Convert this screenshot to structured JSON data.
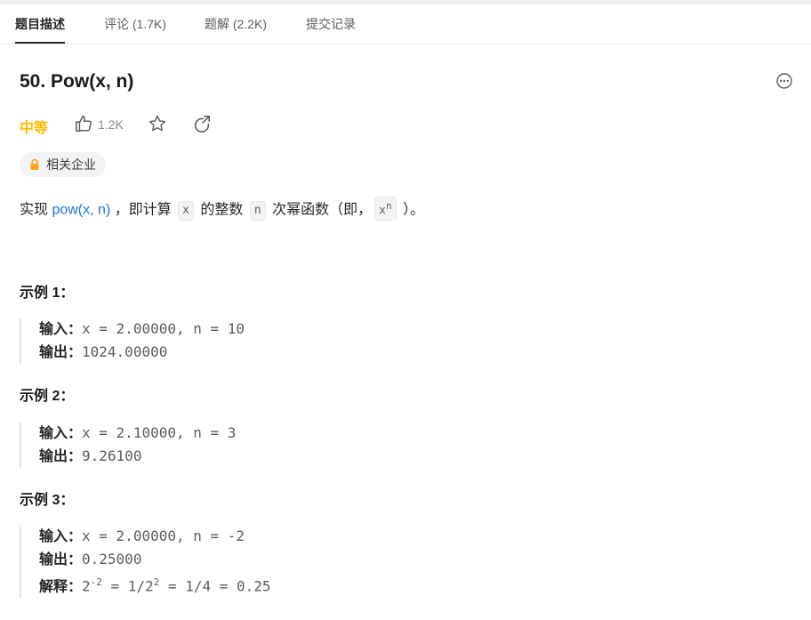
{
  "tabs": [
    {
      "label": "题目描述"
    },
    {
      "label": "评论 (1.7K)"
    },
    {
      "label": "题解 (2.2K)"
    },
    {
      "label": "提交记录"
    }
  ],
  "problem": {
    "title": "50. Pow(x, n)",
    "difficulty": "中等",
    "likes": "1.2K",
    "company_tag": "相关企业"
  },
  "description": {
    "part1": "实现 ",
    "link": "pow(x, n)",
    "part2": " ，即计算 ",
    "code_x": "x",
    "part3": " 的整数 ",
    "code_n": "n",
    "part4": " 次幂函数（即，",
    "power_base": "x",
    "power_exp": "n",
    "part5": " ）。"
  },
  "labels": {
    "input": "输入：",
    "output": "输出：",
    "explain": "解释："
  },
  "examples": [
    {
      "title": "示例 1：",
      "input": "x = 2.00000, n = 10",
      "output": "1024.00000"
    },
    {
      "title": "示例 2：",
      "input": "x = 2.10000, n = 3",
      "output": "9.26100"
    },
    {
      "title": "示例 3：",
      "input": "x = 2.00000, n = -2",
      "output": "0.25000",
      "explain_base": "2",
      "explain_exp1": "-2",
      "explain_mid": " = 1/2",
      "explain_exp2": "2",
      "explain_end": " = 1/4 = 0.25"
    }
  ],
  "colors": {
    "difficulty": "#ffb800",
    "link": "#1a73e8",
    "lock": "#ffa116"
  },
  "icons": [
    "more-icon",
    "thumbs-up-icon",
    "star-icon",
    "share-icon",
    "lock-icon"
  ]
}
